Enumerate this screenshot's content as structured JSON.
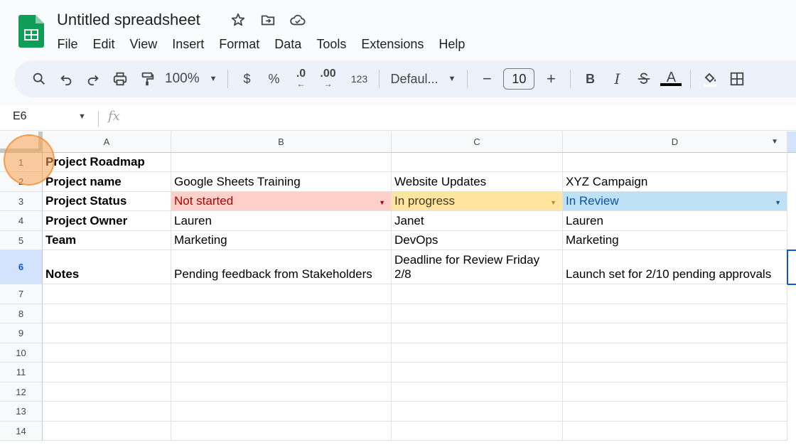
{
  "header": {
    "title": "Untitled spreadsheet",
    "menu": [
      "File",
      "Edit",
      "View",
      "Insert",
      "Format",
      "Data",
      "Tools",
      "Extensions",
      "Help"
    ]
  },
  "toolbar": {
    "zoom": "100%",
    "currency": "$",
    "percent": "%",
    "decrease_decimals": ".0",
    "increase_decimals": ".00",
    "number_format": "123",
    "font": "Defaul...",
    "font_size": "10",
    "minus": "−",
    "plus": "+",
    "bold": "B",
    "italic": "I",
    "text_color_letter": "A"
  },
  "formula_bar": {
    "name_box": "E6",
    "fx": "fx"
  },
  "grid": {
    "columns": [
      "A",
      "B",
      "C",
      "D"
    ],
    "rows": [
      "1",
      "2",
      "3",
      "4",
      "5",
      "6",
      "7",
      "8",
      "9",
      "10",
      "11",
      "12",
      "13",
      "14"
    ],
    "selected_row": "6",
    "cells": {
      "A1": "Project Roadmap",
      "A2": "Project name",
      "B2": "Google Sheets Training",
      "C2": "Website Updates",
      "D2": "XYZ Campaign",
      "A3": "Project Status",
      "B3": "Not started",
      "C3": "In progress",
      "D3": "In Review",
      "A4": "Project Owner",
      "B4": "Lauren",
      "C4": "Janet",
      "D4": "Lauren",
      "A5": "Team",
      "B5": "Marketing",
      "C5": "DevOps",
      "D5": "Marketing",
      "A6": "Notes",
      "B6": "Pending feedback from Stakeholders",
      "C6": "Deadline for Review Friday 2/8",
      "D6": "Launch set for 2/10 pending approvals"
    }
  },
  "colors": {
    "not_started_bg": "#ffcfc9",
    "not_started_text": "#b10202",
    "in_progress_bg": "#ffe5a0",
    "in_progress_text": "#473821",
    "in_review_bg": "#bfe1f6",
    "in_review_text": "#0a53a8",
    "accent": "#0b57d0",
    "sheets_green": "#0f9d58"
  }
}
